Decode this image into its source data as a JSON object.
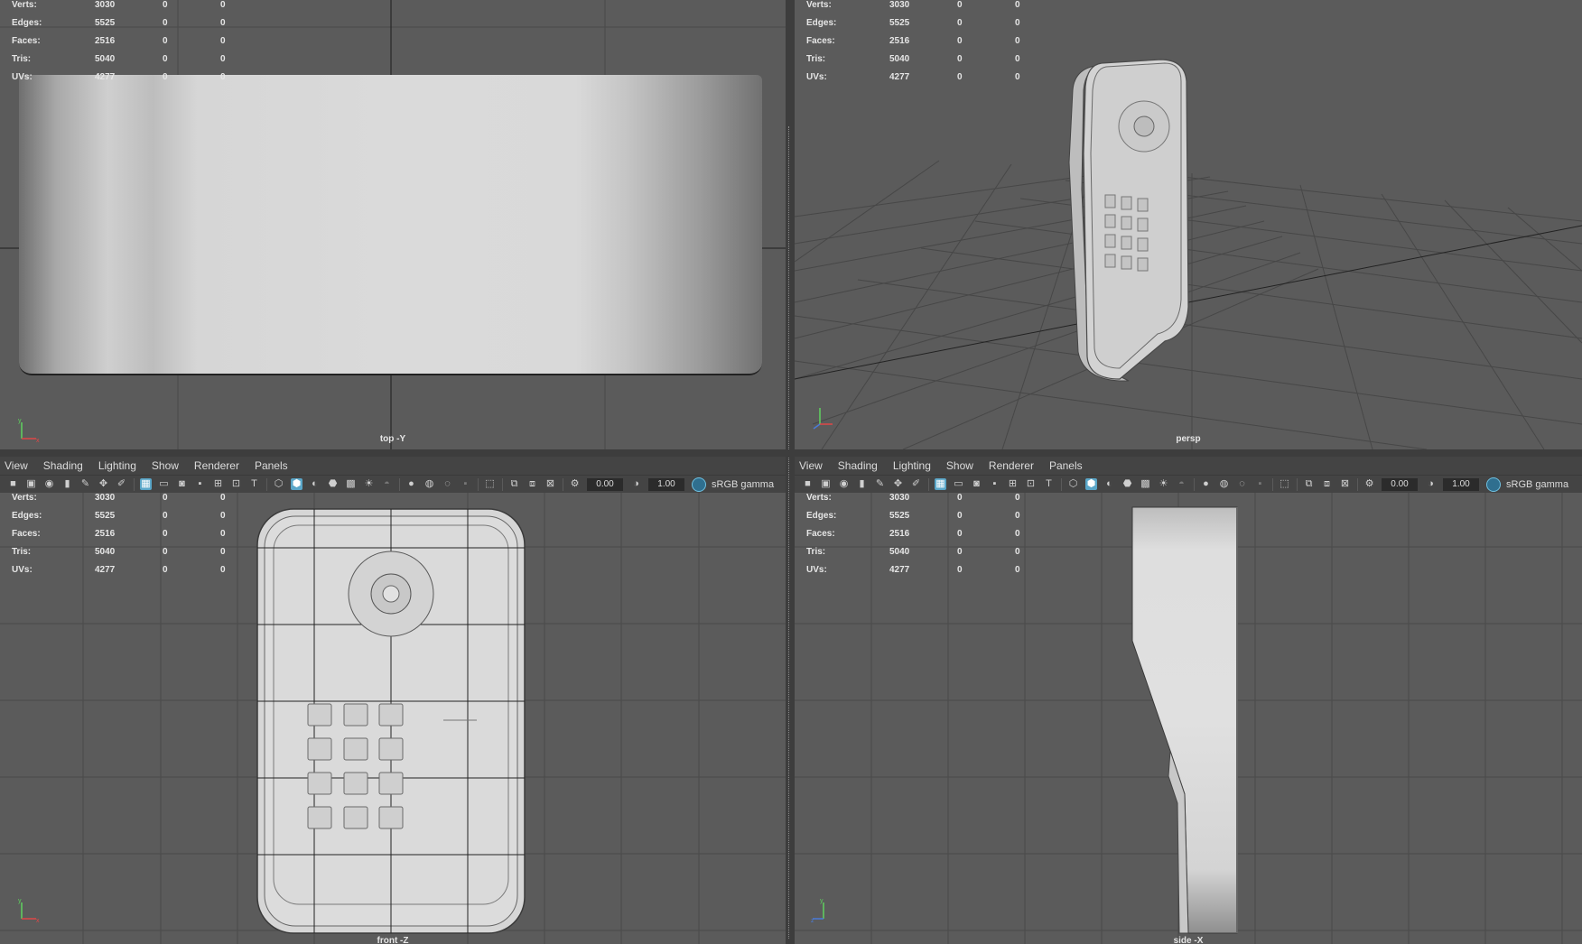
{
  "stats": {
    "rows": [
      {
        "label": "Verts:",
        "v1": "3030",
        "v2": "0",
        "v3": "0"
      },
      {
        "label": "Edges:",
        "v1": "5525",
        "v2": "0",
        "v3": "0"
      },
      {
        "label": "Faces:",
        "v1": "2516",
        "v2": "0",
        "v3": "0"
      },
      {
        "label": "Tris:",
        "v1": "5040",
        "v2": "0",
        "v3": "0"
      },
      {
        "label": "UVs:",
        "v1": "4277",
        "v2": "0",
        "v3": "0"
      }
    ]
  },
  "viewports": {
    "top": {
      "camera": "top -Y"
    },
    "persp": {
      "camera": "persp"
    },
    "front": {
      "camera": "front -Z"
    },
    "side": {
      "camera": "side -X"
    }
  },
  "menus": [
    "View",
    "Shading",
    "Lighting",
    "Show",
    "Renderer",
    "Panels"
  ],
  "toolbar": {
    "exposure": "0.00",
    "gamma_value": "1.00",
    "color_space": "sRGB gamma"
  },
  "colors": {
    "viewport_bg": "#5b5b5b",
    "grid_line": "#4a4a4a",
    "axis_line": "#1e1e1e",
    "active_icon": "#5aa6c8",
    "model": "#d6d6d6"
  }
}
